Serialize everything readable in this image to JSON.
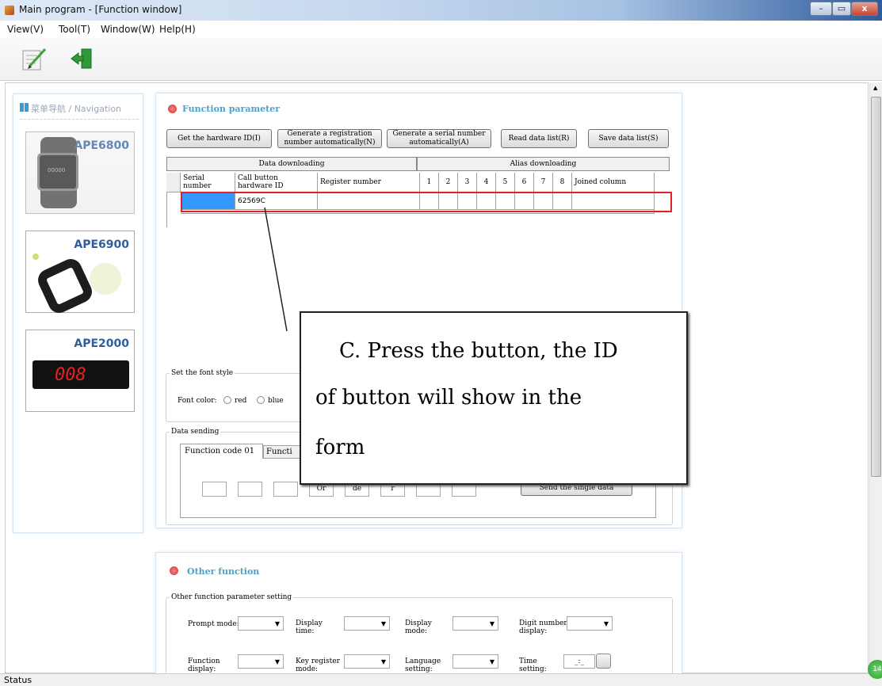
{
  "window": {
    "title": "Main program - [Function window]",
    "minimize": "–",
    "restore": "▭",
    "close": "x"
  },
  "menu": [
    "View(V)",
    "Tool(T)",
    "Window(W)",
    "Help(H)"
  ],
  "toolbar": {
    "icons": [
      "edit-icon",
      "exit-icon"
    ]
  },
  "nav": {
    "header": "菜单导航 / Navigation",
    "products": [
      {
        "name": "APE6800",
        "screen": "00000"
      },
      {
        "name": "APE6900"
      },
      {
        "name": "APE2000",
        "display": "008"
      }
    ]
  },
  "function_param": {
    "title": "Function parameter",
    "buttons": [
      "Get the hardware ID(I)",
      "Generate a registration number automatically(N)",
      "Generate a serial number automatically(A)",
      "Read data list(R)",
      "Save data list(S)"
    ],
    "group_headers": [
      "Data downloading",
      "Alias downloading"
    ],
    "columns": [
      "Serial number",
      "Call button hardware ID",
      "Register number",
      "1",
      "2",
      "3",
      "4",
      "5",
      "6",
      "7",
      "8",
      "Joined column"
    ],
    "row": {
      "serial": "",
      "hardware_id": "62569C"
    },
    "font_style": {
      "label": "Set the font style",
      "color_label": "Font color:",
      "options": [
        "red",
        "blue"
      ]
    },
    "data_sending": {
      "label": "Data sending",
      "tabs": [
        "Function code 01",
        "Functi"
      ],
      "boxes": [
        "",
        "",
        "",
        "Or",
        "de",
        "r",
        "",
        ""
      ],
      "send_button": "Send the single data"
    }
  },
  "callout": {
    "line1": "C. Press the button, the ID",
    "line2": "of button will show in the",
    "line3": "form",
    "highlight_color": "#e2202a"
  },
  "other": {
    "title": "Other function",
    "group": "Other function parameter setting",
    "fields": [
      {
        "label": "Prompt mode:"
      },
      {
        "label": "Display time:"
      },
      {
        "label": "Display mode:"
      },
      {
        "label": "Digit number display:"
      },
      {
        "label": "Function display:"
      },
      {
        "label": "Key register mode:"
      },
      {
        "label": "Language setting:"
      },
      {
        "label": "Time setting:"
      }
    ],
    "time_value": "_:_"
  },
  "status": {
    "text": "Status",
    "badge": "14"
  }
}
